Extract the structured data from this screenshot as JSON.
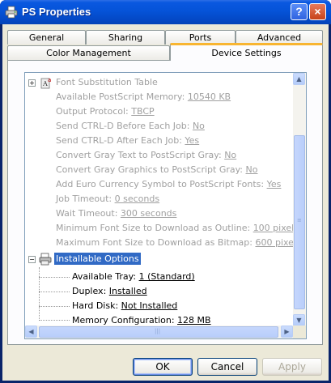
{
  "window": {
    "title": "PS Properties",
    "help_label": "?",
    "close_label": "×"
  },
  "tabs": {
    "back_row": [
      "General",
      "Sharing",
      "Ports",
      "Advanced"
    ],
    "front_row": [
      "Color Management",
      "Device Settings"
    ],
    "active": "Device Settings"
  },
  "tree": {
    "gray_items": [
      {
        "label": "Font Substitution Table",
        "value": ""
      },
      {
        "label": "Available PostScript Memory: ",
        "value": "10540 KB"
      },
      {
        "label": "Output Protocol: ",
        "value": "TBCP"
      },
      {
        "label": "Send CTRL-D Before Each Job: ",
        "value": "No"
      },
      {
        "label": "Send CTRL-D After Each Job: ",
        "value": "Yes"
      },
      {
        "label": "Convert Gray Text to PostScript Gray: ",
        "value": "No"
      },
      {
        "label": "Convert Gray Graphics to PostScript Gray: ",
        "value": "No"
      },
      {
        "label": "Add Euro Currency Symbol to PostScript Fonts: ",
        "value": "Yes"
      },
      {
        "label": "Job Timeout: ",
        "value": "0 seconds"
      },
      {
        "label": "Wait Timeout: ",
        "value": "300 seconds"
      },
      {
        "label": "Minimum Font Size to Download as Outline: ",
        "value": "100 pixel(s)"
      },
      {
        "label": "Maximum Font Size to Download as Bitmap: ",
        "value": "600 pixel(s)"
      }
    ],
    "installable_options": {
      "label": "Installable Options",
      "children": [
        {
          "label": "Available Tray: ",
          "value": "1 (Standard)"
        },
        {
          "label": "Duplex: ",
          "value": "Installed"
        },
        {
          "label": "Hard Disk: ",
          "value": "Not Installed"
        },
        {
          "label": "Memory Configuration: ",
          "value": "128 MB"
        }
      ]
    }
  },
  "buttons": {
    "ok": "OK",
    "cancel": "Cancel",
    "apply": "Apply"
  },
  "colors": {
    "titlebar": "#0553d8",
    "selection": "#316ac5",
    "active_tab_accent": "#f8b531",
    "disabled_text": "#a0a0a0"
  }
}
